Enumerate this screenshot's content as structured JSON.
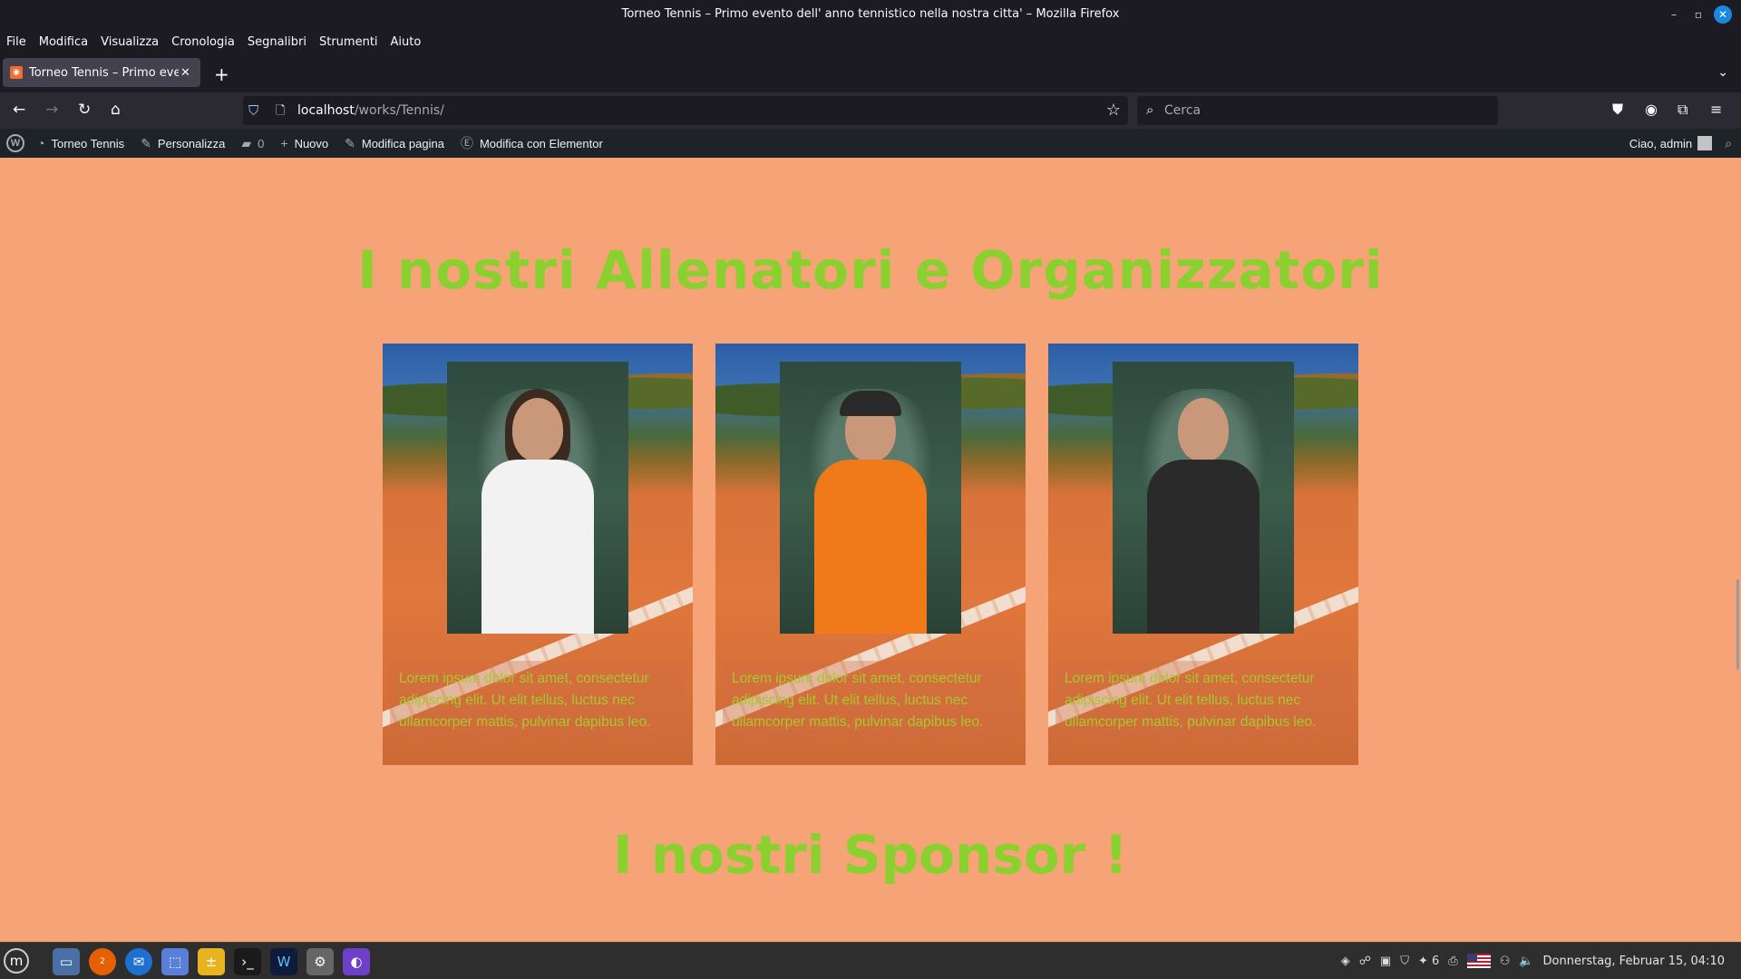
{
  "window": {
    "title": "Torneo Tennis – Primo evento dell' anno tennistico nella nostra citta' – Mozilla Firefox",
    "minimize": "–",
    "restore": "▫",
    "close": "✕"
  },
  "menu": [
    "File",
    "Modifica",
    "Visualizza",
    "Cronologia",
    "Segnalibri",
    "Strumenti",
    "Aiuto"
  ],
  "tab": {
    "label": "Torneo Tennis – Primo evento",
    "close": "✕",
    "new_tab": "+",
    "list": "⌄"
  },
  "nav": {
    "back": "←",
    "forward": "→",
    "reload": "↻",
    "home": "⌂",
    "url_host": "localhost",
    "url_path": "/works/Tennis/",
    "bookmark": "☆",
    "search_placeholder": "Cerca"
  },
  "wp_admin": {
    "site_name": "Torneo Tennis",
    "customize": "Personalizza",
    "comments": "0",
    "new": "Nuovo",
    "edit_page": "Modifica pagina",
    "elementor": "Modifica con Elementor",
    "greeting": "Ciao, admin"
  },
  "page": {
    "heading_coaches": "I nostri Allenatori e Organizzatori",
    "heading_sponsors": "I nostri Sponsor !",
    "cards": [
      {
        "caption": "Lorem ipsum dolor sit amet, consectetur adipiscing elit. Ut elit tellus, luctus nec ullamcorper mattis, pulvinar dapibus leo.",
        "shirt_color": "#f2f2f2"
      },
      {
        "caption": "Lorem ipsum dolor sit amet, consectetur adipiscing elit. Ut elit tellus, luctus nec ullamcorper mattis, pulvinar dapibus leo.",
        "shirt_color": "#f07a1a"
      },
      {
        "caption": "Lorem ipsum dolor sit amet, consectetur adipiscing elit. Ut elit tellus, luctus nec ullamcorper mattis, pulvinar dapibus leo.",
        "shirt_color": "#2a2a2a"
      }
    ]
  },
  "taskbar": {
    "datetime": "Donnerstag, Februar 15, 04:10",
    "notif_count": "6",
    "firefox_badge": "2"
  },
  "colors": {
    "page_bg": "#f6a378",
    "heading": "#8ad130",
    "caption_text": "#a6c82b"
  }
}
